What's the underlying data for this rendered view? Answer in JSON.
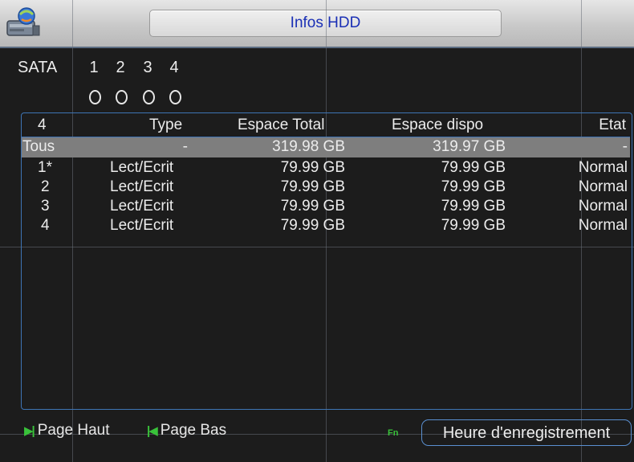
{
  "window": {
    "title": "Infos HDD"
  },
  "sata": {
    "label": "SATA",
    "ports": [
      "1",
      "2",
      "3",
      "4"
    ],
    "status": [
      "O",
      "O",
      "O",
      "O"
    ]
  },
  "table": {
    "headers": {
      "id": "4",
      "type": "Type",
      "total": "Espace Total",
      "free": "Espace dispo",
      "state": "Etat"
    },
    "rows": [
      {
        "id": "Tous",
        "type": "-",
        "total": "319.98 GB",
        "free": "319.97 GB",
        "state": "-"
      },
      {
        "id": "1*",
        "type": "Lect/Ecrit",
        "total": "79.99 GB",
        "free": "79.99 GB",
        "state": "Normal"
      },
      {
        "id": "2",
        "type": "Lect/Ecrit",
        "total": "79.99 GB",
        "free": "79.99 GB",
        "state": "Normal"
      },
      {
        "id": "3",
        "type": "Lect/Ecrit",
        "total": "79.99 GB",
        "free": "79.99 GB",
        "state": "Normal"
      },
      {
        "id": "4",
        "type": "Lect/Ecrit",
        "total": "79.99 GB",
        "free": "79.99 GB",
        "state": "Normal"
      }
    ]
  },
  "footer": {
    "page_up": "Page Haut",
    "page_down": "Page Bas",
    "fn_label": "Fn",
    "record_time": "Heure d'enregistrement"
  },
  "colors": {
    "accent": "#3e74b4",
    "title_text": "#1a2fb5",
    "nav_arrows": "#39c23a",
    "selected_row": "#7e7e7e"
  }
}
